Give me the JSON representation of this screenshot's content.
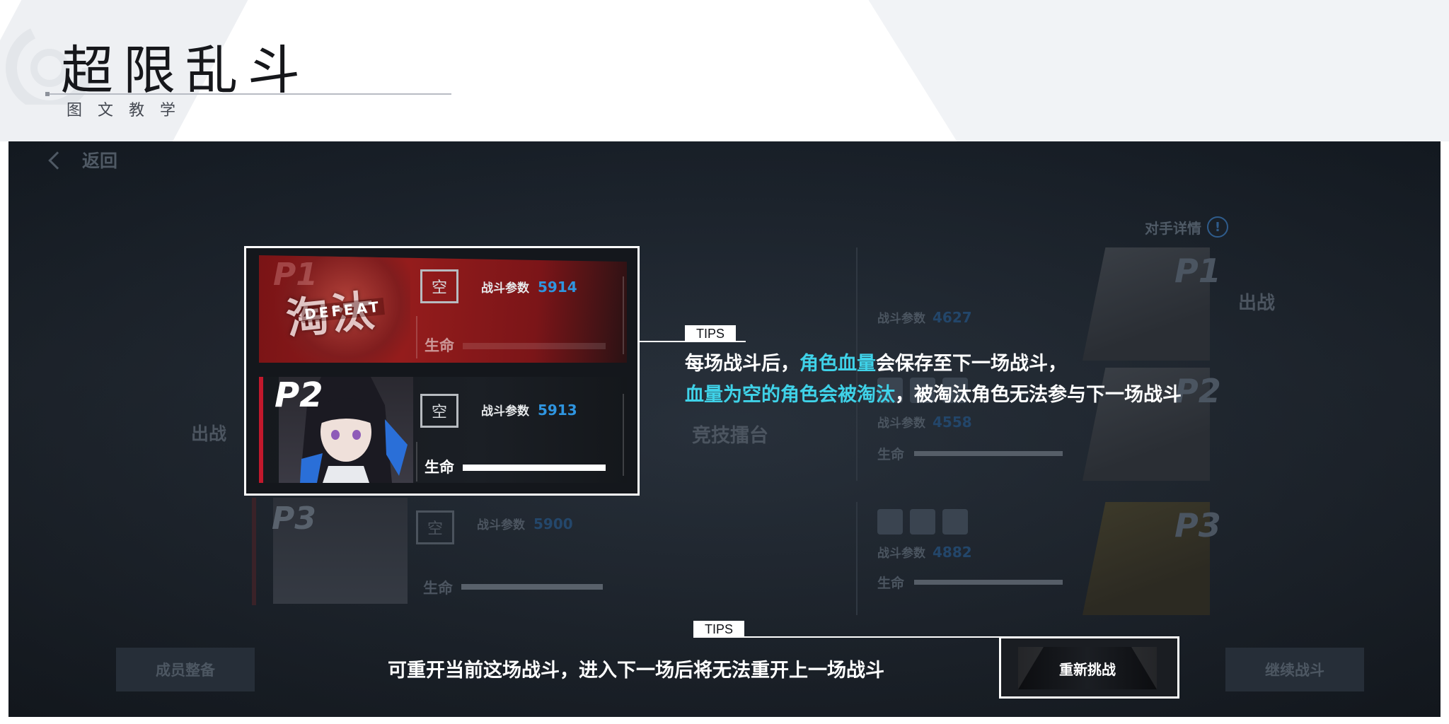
{
  "header": {
    "title": "超限乱斗",
    "subtitle": "图文教学"
  },
  "game": {
    "back_label": "返回",
    "opponent_detail_label": "对手详情",
    "deploy_label": "出战",
    "arena_label": "竞技擂台",
    "my_team": [
      {
        "slot": "P1",
        "status": "淘汰",
        "status_en": "DEFEAT",
        "empty_label": "空",
        "stat_label": "战斗参数",
        "stat_value": "5914",
        "life_label": "生命",
        "life": 0
      },
      {
        "slot": "P2",
        "empty_label": "空",
        "stat_label": "战斗参数",
        "stat_value": "5913",
        "life_label": "生命",
        "life": 1
      },
      {
        "slot": "P3",
        "empty_label": "空",
        "stat_label": "战斗参数",
        "stat_value": "5900",
        "life_label": "生命",
        "life": 1
      }
    ],
    "opponents": [
      {
        "slot": "P1",
        "stat_label": "战斗参数",
        "stat_value": "4627"
      },
      {
        "slot": "P2",
        "stat_label": "战斗参数",
        "stat_value": "4558",
        "life_label": "生命"
      },
      {
        "slot": "P3",
        "stat_label": "战斗参数",
        "stat_value": "4882",
        "life_label": "生命"
      }
    ],
    "buttons": {
      "member_prep": "成员整备",
      "retry": "重新挑战",
      "continue": "继续战斗"
    }
  },
  "tips": [
    {
      "tag": "TIPS",
      "line1_a": "每场战斗后，",
      "line1_hl": "角色血量",
      "line1_b": "会保存至下一场战斗，",
      "line2_hl": "血量为空的角色会被淘汰",
      "line2_b": "，被淘汰角色无法参与下一场战斗"
    },
    {
      "tag": "TIPS",
      "text": "可重开当前这场战斗，进入下一场后将无法重开上一场战斗"
    }
  ],
  "colors": {
    "highlight": "#3fd2e8",
    "stat_value": "#2f95e0",
    "defeat_red": "#941c1c",
    "accent_red": "#c2182c"
  }
}
